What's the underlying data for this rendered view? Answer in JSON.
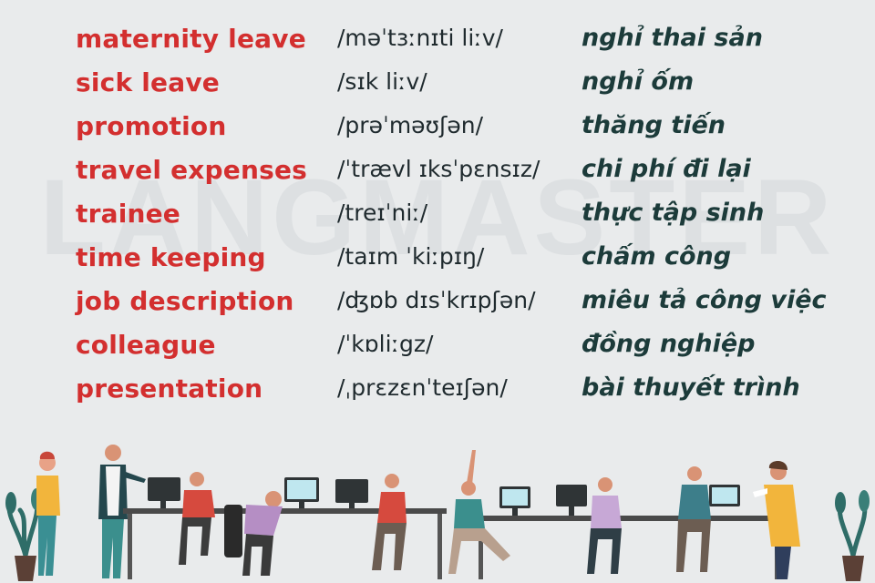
{
  "watermark": "LANGMASTER",
  "vocabulary": [
    {
      "term": "maternity leave",
      "ipa": "/məˈtɜːnɪti liːv/",
      "meaning": "nghỉ thai sản"
    },
    {
      "term": "sick leave",
      "ipa": "/sɪk liːv/",
      "meaning": "nghỉ ốm"
    },
    {
      "term": "promotion",
      "ipa": "/prəˈməʊʃən/",
      "meaning": "thăng tiến"
    },
    {
      "term": "travel expenses",
      "ipa": "/ˈtrævl ɪksˈpɛnsɪz/",
      "meaning": "chi phí đi lại"
    },
    {
      "term": "trainee",
      "ipa": "/treɪˈniː/",
      "meaning": "thực tập sinh"
    },
    {
      "term": "time keeping",
      "ipa": "/taɪm ˈkiːpɪŋ/",
      "meaning": "chấm công"
    },
    {
      "term": "job description",
      "ipa": "/ʤɒb dɪsˈkrɪpʃən/",
      "meaning": "miêu tả công việc"
    },
    {
      "term": "colleague",
      "ipa": "/ˈkɒliːgz/",
      "meaning": "đồng nghiệp"
    },
    {
      "term": "presentation",
      "ipa": "/ˌprɛzɛnˈteɪʃən/",
      "meaning": "bài thuyết trình"
    }
  ],
  "colors": {
    "background": "#e9ebec",
    "term": "#d32f2f",
    "ipa": "#1f2a2e",
    "meaning": "#1c3b3a"
  }
}
